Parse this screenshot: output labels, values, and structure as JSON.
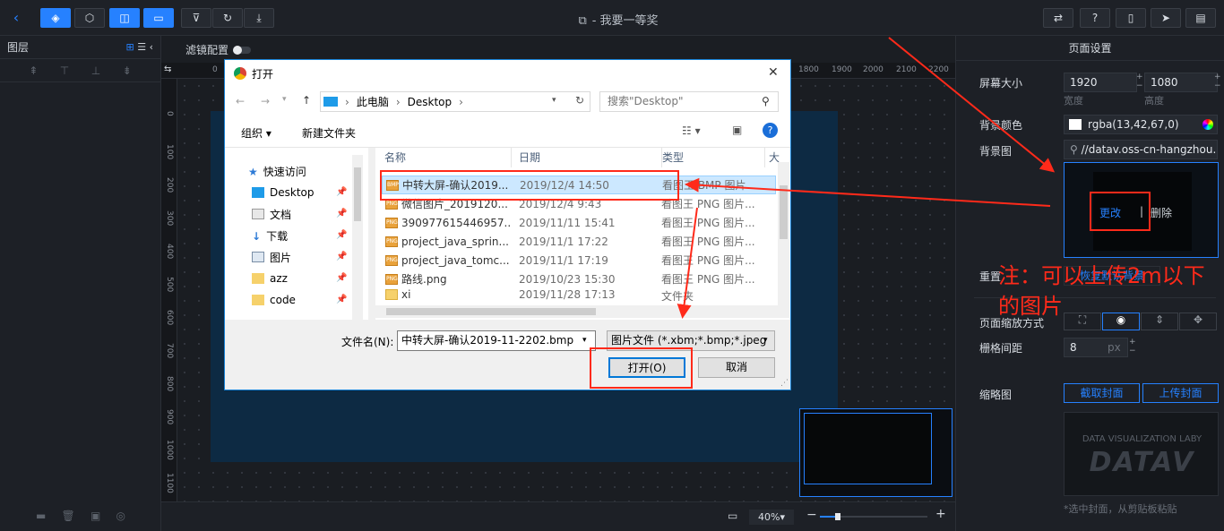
{
  "topbar": {
    "title": "- 我要一等奖",
    "left_buttons": [
      "back-icon",
      "layers-icon",
      "component-icon",
      "panel-icon",
      "toolbox-icon",
      "filter-icon",
      "refresh-icon",
      "download-icon"
    ],
    "right_buttons": [
      "publish-icon",
      "help-icon",
      "preview-icon",
      "send-icon",
      "settings-icon"
    ]
  },
  "left_panel": {
    "title": "图层"
  },
  "canvas": {
    "filter_label": "滤镜配置",
    "ruler_x": [
      "0",
      "1800",
      "1900",
      "2000",
      "2100",
      "2200"
    ],
    "ruler_y": [
      "0",
      "100",
      "200",
      "300",
      "400",
      "500",
      "600",
      "700",
      "800",
      "900",
      "1000",
      "1100"
    ],
    "zoom": "40%"
  },
  "right_panel": {
    "title": "页面设置",
    "screen_size_label": "屏幕大小",
    "width": "1920",
    "height": "1080",
    "width_label": "宽度",
    "height_label": "高度",
    "bg_color_label": "背景颜色",
    "bg_color_value": "rgba(13,42,67,0)",
    "bg_image_label": "背景图",
    "bg_image_url": "//datav.oss-cn-hangzhou.a",
    "change": "更改",
    "separator": "|",
    "delete": "删除",
    "reset_label": "重置",
    "reset_button": "恢复默认背景",
    "scale_label": "页面缩放方式",
    "grid_label": "栅格间距",
    "grid_value": "8",
    "grid_unit": "px",
    "thumb_label": "缩略图",
    "capture_button": "截取封面",
    "upload_button": "上传封面",
    "thumb_brand_small": "DATA VISUALIZATION LABY",
    "thumb_brand": "DATAV",
    "thumb_hint": "*选中封面，从剪贴板粘贴"
  },
  "dialog": {
    "title": "打开",
    "breadcrumb": [
      "此电脑",
      "Desktop"
    ],
    "search_placeholder": "搜索\"Desktop\"",
    "organize": "组织 ▾",
    "new_folder": "新建文件夹",
    "nav": [
      {
        "label": "快速访问"
      },
      {
        "label": "Desktop"
      },
      {
        "label": "文档"
      },
      {
        "label": "下载"
      },
      {
        "label": "图片"
      },
      {
        "label": "azz"
      },
      {
        "label": "code"
      }
    ],
    "columns": [
      "名称",
      "日期",
      "类型",
      "大"
    ],
    "files": [
      {
        "name": "中转大屏-确认2019...",
        "date": "2019/12/4 14:50",
        "type": "看图王 BMP 图片"
      },
      {
        "name": "微信图片_2019120...",
        "date": "2019/12/4 9:43",
        "type": "看图王 PNG 图片..."
      },
      {
        "name": "390977615446957...",
        "date": "2019/11/11 15:41",
        "type": "看图王 PNG 图片..."
      },
      {
        "name": "project_java_sprin...",
        "date": "2019/11/1 17:22",
        "type": "看图王 PNG 图片..."
      },
      {
        "name": "project_java_tomc...",
        "date": "2019/11/1 17:19",
        "type": "看图王 PNG 图片..."
      },
      {
        "name": "路线.png",
        "date": "2019/10/23 15:30",
        "type": "看图王 PNG 图片..."
      },
      {
        "name": "xi",
        "date": "2019/11/28 17:13",
        "type": "文件夹"
      }
    ],
    "filename_label": "文件名(N):",
    "filename_value": "中转大屏-确认2019-11-2202.bmp",
    "filetype": "图片文件 (*.xbm;*.bmp;*.jpeg",
    "open_button": "打开(O)",
    "cancel_button": "取消"
  },
  "annotation": {
    "note": "注：可以上传2m以下的图片",
    "color": "#ff2a1a"
  }
}
